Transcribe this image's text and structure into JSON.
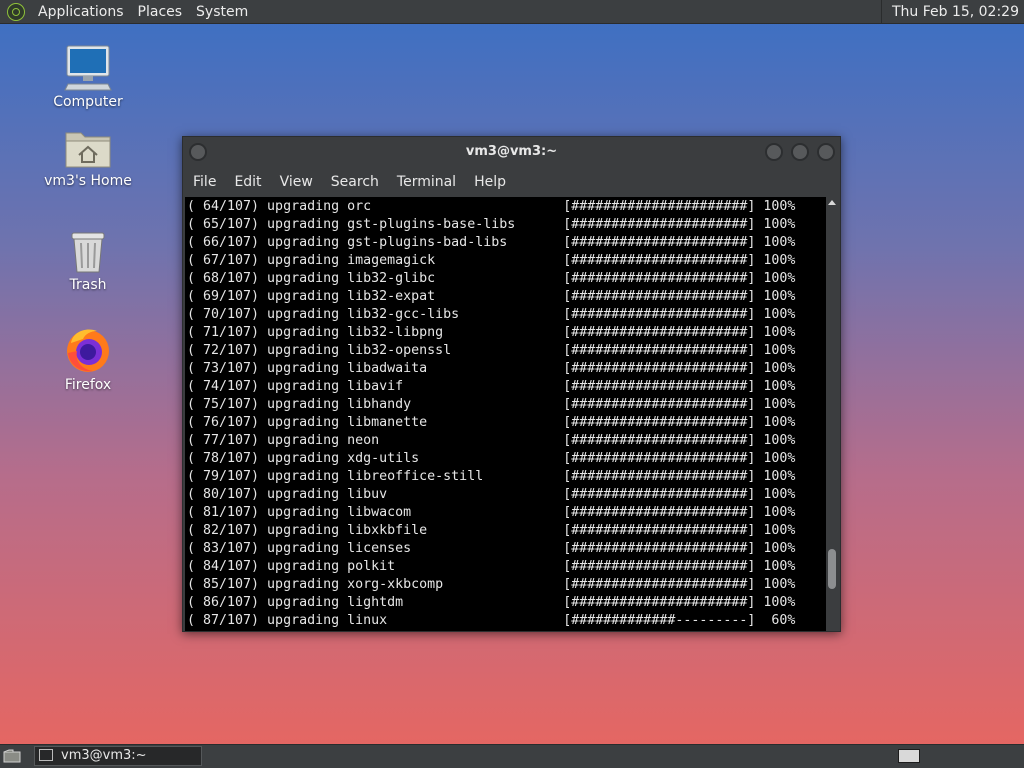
{
  "top_panel": {
    "menus": [
      "Applications",
      "Places",
      "System"
    ],
    "clock": "Thu Feb 15, 02:29"
  },
  "desktop_icons": [
    {
      "label": "Computer",
      "icon": "computer-icon"
    },
    {
      "label": "vm3's Home",
      "icon": "home-folder-icon"
    },
    {
      "label": "Trash",
      "icon": "trash-icon"
    },
    {
      "label": "Firefox",
      "icon": "firefox-icon"
    }
  ],
  "terminal": {
    "title": "vm3@vm3:~",
    "menu": [
      "File",
      "Edit",
      "View",
      "Search",
      "Terminal",
      "Help"
    ],
    "lines": [
      "( 64/107) upgrading orc                        [######################] 100%",
      "( 65/107) upgrading gst-plugins-base-libs      [######################] 100%",
      "( 66/107) upgrading gst-plugins-bad-libs       [######################] 100%",
      "( 67/107) upgrading imagemagick                [######################] 100%",
      "( 68/107) upgrading lib32-glibc                [######################] 100%",
      "( 69/107) upgrading lib32-expat                [######################] 100%",
      "( 70/107) upgrading lib32-gcc-libs             [######################] 100%",
      "( 71/107) upgrading lib32-libpng               [######################] 100%",
      "( 72/107) upgrading lib32-openssl              [######################] 100%",
      "( 73/107) upgrading libadwaita                 [######################] 100%",
      "( 74/107) upgrading libavif                    [######################] 100%",
      "( 75/107) upgrading libhandy                   [######################] 100%",
      "( 76/107) upgrading libmanette                 [######################] 100%",
      "( 77/107) upgrading neon                       [######################] 100%",
      "( 78/107) upgrading xdg-utils                  [######################] 100%",
      "( 79/107) upgrading libreoffice-still          [######################] 100%",
      "( 80/107) upgrading libuv                      [######################] 100%",
      "( 81/107) upgrading libwacom                   [######################] 100%",
      "( 82/107) upgrading libxkbfile                 [######################] 100%",
      "( 83/107) upgrading licenses                   [######################] 100%",
      "( 84/107) upgrading polkit                     [######################] 100%",
      "( 85/107) upgrading xorg-xkbcomp               [######################] 100%",
      "( 86/107) upgrading lightdm                    [######################] 100%",
      "( 87/107) upgrading linux                      [#############---------]  60%"
    ],
    "scroll_position": 0.9
  },
  "taskbar": {
    "window_label": "vm3@vm3:~"
  },
  "colors": {
    "panel": "#3c3f41",
    "terminal_bg": "#000000",
    "terminal_fg": "#e6e6e6"
  }
}
